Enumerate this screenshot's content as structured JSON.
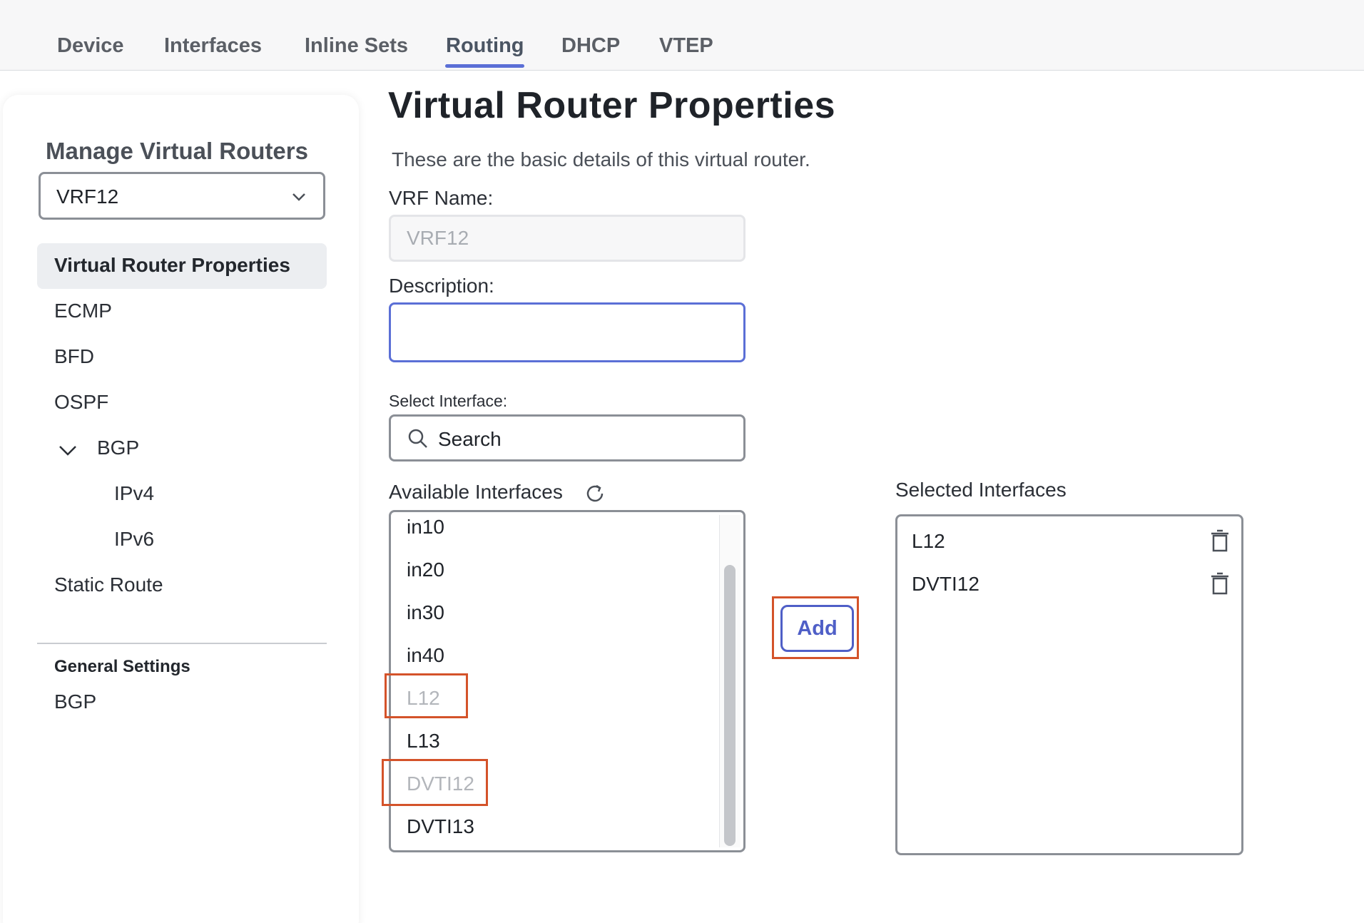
{
  "tabs": [
    {
      "label": "Device"
    },
    {
      "label": "Interfaces"
    },
    {
      "label": "Inline Sets"
    },
    {
      "label": "Routing"
    },
    {
      "label": "DHCP"
    },
    {
      "label": "VTEP"
    }
  ],
  "active_tab": "Routing",
  "sidebar": {
    "title": "Manage Virtual Routers",
    "vrf_selected": "VRF12",
    "items": [
      {
        "label": "Virtual Router Properties"
      },
      {
        "label": "ECMP"
      },
      {
        "label": "BFD"
      },
      {
        "label": "OSPF"
      },
      {
        "label": "BGP"
      },
      {
        "label": "IPv4"
      },
      {
        "label": "IPv6"
      },
      {
        "label": "Static Route"
      }
    ],
    "general_settings": {
      "title": "General Settings",
      "items": [
        {
          "label": "BGP"
        }
      ]
    }
  },
  "main": {
    "title": "Virtual Router Properties",
    "subtitle": "These are the basic details of this virtual router.",
    "vrf_name_label": "VRF Name:",
    "vrf_name_value": "VRF12",
    "description_label": "Description:",
    "description_value": "",
    "select_interface_label": "Select Interface:",
    "search_placeholder": "Search",
    "available_label": "Available Interfaces",
    "available_interfaces": [
      {
        "label": "in10",
        "disabled": false
      },
      {
        "label": "in20",
        "disabled": false
      },
      {
        "label": "in30",
        "disabled": false
      },
      {
        "label": "in40",
        "disabled": false
      },
      {
        "label": "L12",
        "disabled": true
      },
      {
        "label": "L13",
        "disabled": false
      },
      {
        "label": "DVTI12",
        "disabled": true
      },
      {
        "label": "DVTI13",
        "disabled": false
      }
    ],
    "add_label": "Add",
    "selected_label": "Selected Interfaces",
    "selected_interfaces": [
      {
        "label": "L12"
      },
      {
        "label": "DVTI12"
      }
    ]
  },
  "colors": {
    "accent": "#5b6fd6",
    "highlight": "#d4532a",
    "disabled_text": "#b3b6bb"
  },
  "icons": [
    "chevron-down-icon",
    "search-icon",
    "refresh-icon",
    "trash-icon"
  ]
}
